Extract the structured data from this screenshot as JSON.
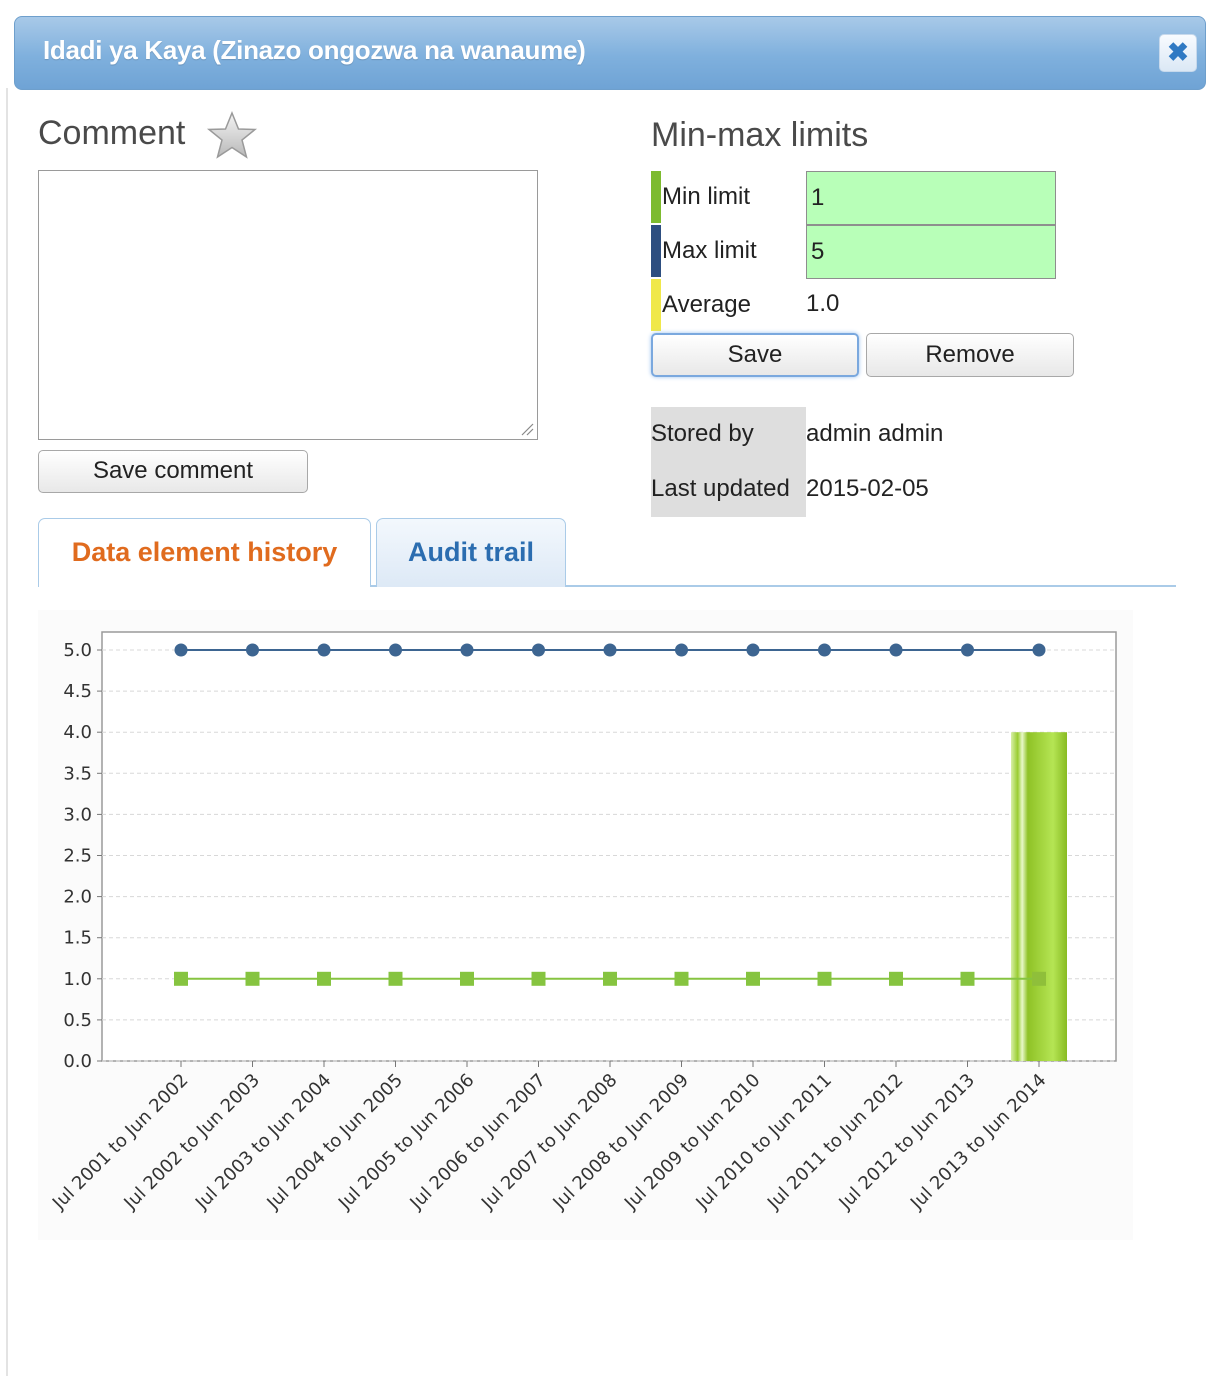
{
  "dialog": {
    "title": "Idadi ya Kaya (Zinazo ongozwa na wanaume)",
    "close_label": "✖"
  },
  "comment": {
    "heading": "Comment",
    "value": "",
    "save_label": "Save comment"
  },
  "limits": {
    "heading": "Min-max limits",
    "min_label": "Min limit",
    "min_value": "1",
    "max_label": "Max limit",
    "max_value": "5",
    "average_label": "Average",
    "average_value": "1.0",
    "save_label": "Save",
    "remove_label": "Remove",
    "colors": {
      "min": "#7dbb2f",
      "max": "#2d4e80",
      "average": "#f0e84a",
      "input_bg": "#b8ffb8"
    }
  },
  "meta": {
    "stored_by_label": "Stored by",
    "stored_by_value": "admin admin",
    "last_updated_label": "Last updated",
    "last_updated_value": "2015-02-05"
  },
  "tabs": {
    "history_label": "Data element history",
    "audit_label": "Audit trail"
  },
  "chart_data": {
    "type": "bar",
    "categories": [
      "Jul 2001 to Jun 2002",
      "Jul 2002 to Jun 2003",
      "Jul 2003 to Jun 2004",
      "Jul 2004 to Jun 2005",
      "Jul 2005 to Jun 2006",
      "Jul 2006 to Jun 2007",
      "Jul 2007 to Jun 2008",
      "Jul 2008 to Jun 2009",
      "Jul 2009 to Jun 2010",
      "Jul 2010 to Jun 2011",
      "Jul 2011 to Jun 2012",
      "Jul 2012 to Jun 2013",
      "Jul 2013 to Jun 2014"
    ],
    "yticks": [
      "0.0",
      "0.5",
      "1.0",
      "1.5",
      "2.0",
      "2.5",
      "3.0",
      "3.5",
      "4.0",
      "4.5",
      "5.0"
    ],
    "ylim": [
      0,
      5
    ],
    "grid": true,
    "series": [
      {
        "kind": "bar",
        "color": "#9acd32",
        "values": [
          null,
          null,
          null,
          null,
          null,
          null,
          null,
          null,
          null,
          null,
          null,
          null,
          4
        ]
      },
      {
        "kind": "line",
        "marker": "circle",
        "color": "#3d6591",
        "values": [
          5,
          5,
          5,
          5,
          5,
          5,
          5,
          5,
          5,
          5,
          5,
          5,
          5
        ]
      },
      {
        "kind": "line",
        "marker": "square",
        "color": "#86c440",
        "values": [
          1,
          1,
          1,
          1,
          1,
          1,
          1,
          1,
          1,
          1,
          1,
          1,
          1
        ]
      }
    ]
  }
}
